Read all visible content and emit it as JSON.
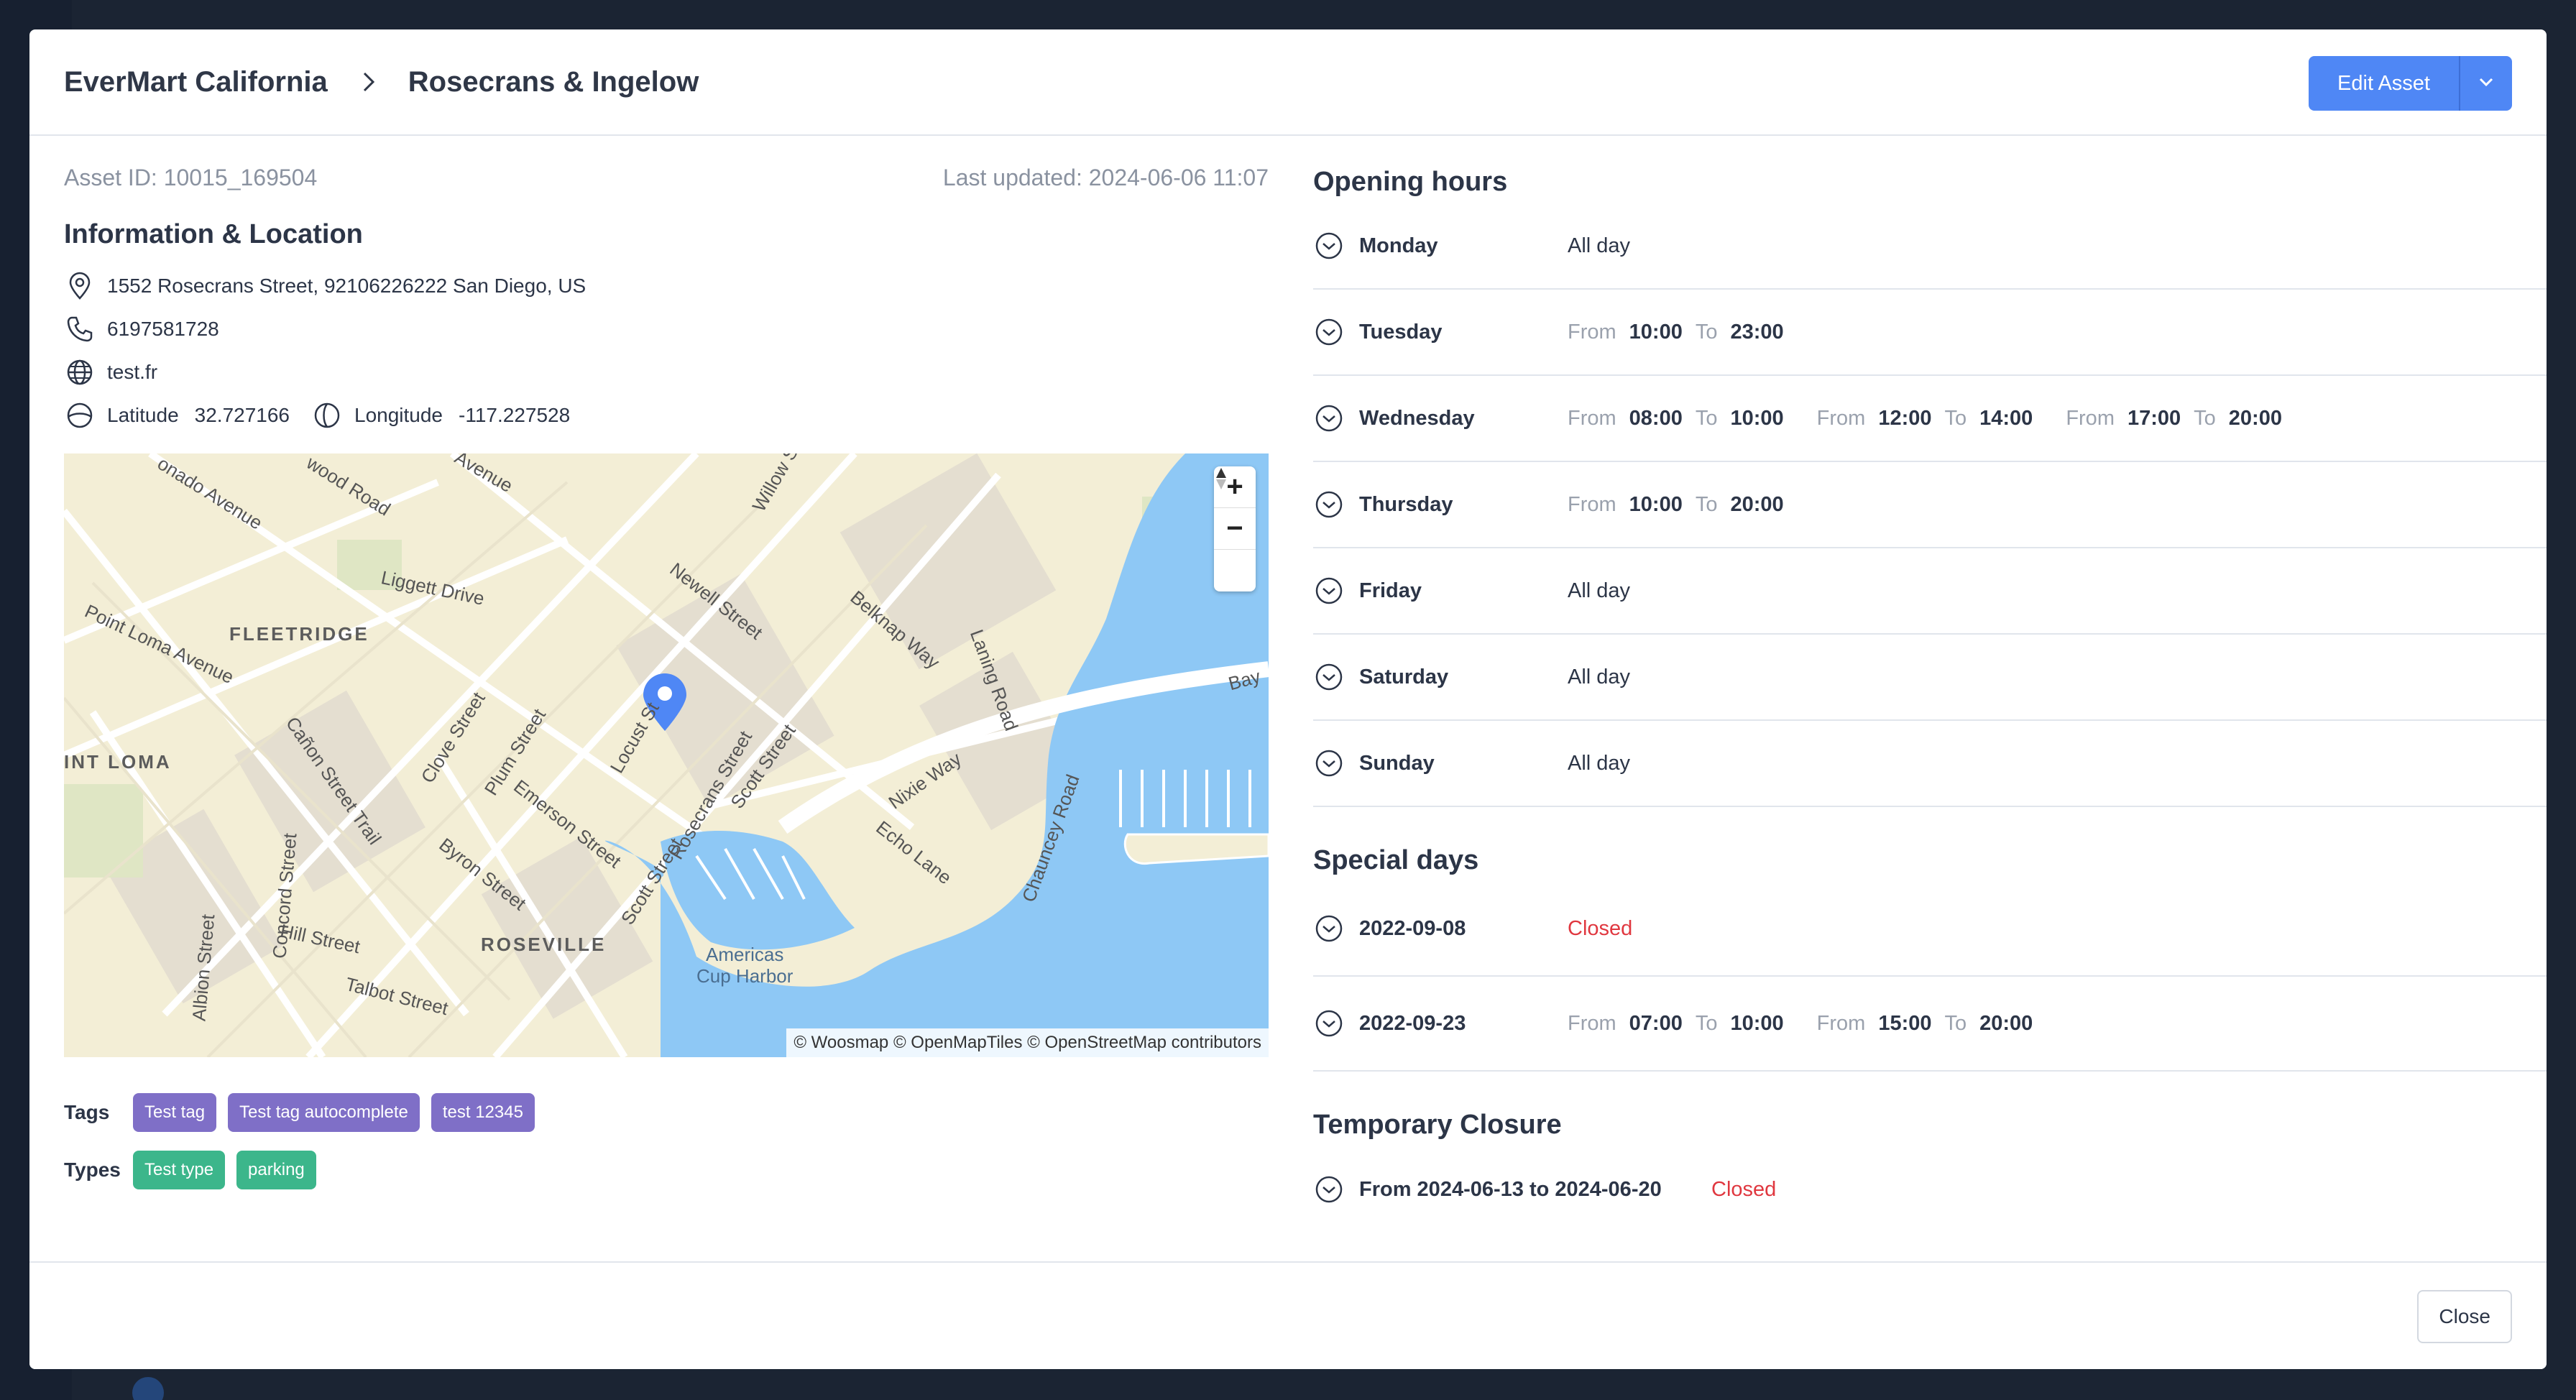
{
  "header": {
    "breadcrumb_parent": "EverMart California",
    "breadcrumb_current": "Rosecrans & Ingelow",
    "edit_button": "Edit Asset"
  },
  "asset": {
    "id_text": "Asset ID: 10015_169504",
    "last_updated": "Last updated: 2024-06-06 11:07",
    "section_title": "Information & Location",
    "address": "1552 Rosecrans Street, 92106226222 San Diego, US",
    "phone": "6197581728",
    "website": "test.fr",
    "latitude_label": "Latitude",
    "latitude": "32.727166",
    "longitude_label": "Longitude",
    "longitude": "-117.227528"
  },
  "map": {
    "attribution": "© Woosmap © OpenMapTiles © OpenStreetMap contributors",
    "zoom_in": "+",
    "zoom_out": "−",
    "labels": {
      "fleetridge": "FLEETRIDGE",
      "point_loma": "INT LOMA",
      "roseville": "ROSEVILLE",
      "americas_cup": "Americas",
      "americas_cup2": "Cup Harbor",
      "liggett": "Liggett Drive",
      "point_loma_ave": "Point Loma Avenue",
      "newell": "Newell Street",
      "belknap": "Belknap Way",
      "laning": "Laning Road",
      "nixie": "Nixie Way",
      "echo": "Echo Lane",
      "chauncey": "Chauncey Road",
      "rosecrans": "Rosecrans Street",
      "scott": "Scott Street",
      "scott2": "Scott Street",
      "locust": "Locust St",
      "clove": "Clove Street",
      "plum": "Plum Street",
      "emerson": "Emerson Street",
      "byron": "Byron Street",
      "hill": "Hill Street",
      "talbot": "Talbot Street",
      "canon": "Cañon Street Trail",
      "concord": "Concord Street",
      "albion": "Albion Street",
      "willow": "Willow S",
      "bay": "Bay",
      "coronado": "onado Avenue",
      "wood": "wood Road",
      "avenue": "Avenue"
    }
  },
  "tags": {
    "label": "Tags",
    "items": [
      "Test tag",
      "Test tag autocomplete",
      "test 12345"
    ]
  },
  "types": {
    "label": "Types",
    "items": [
      "Test type",
      "parking"
    ]
  },
  "opening_hours": {
    "title": "Opening hours",
    "from_word": "From",
    "to_word": "To",
    "days": [
      {
        "name": "Monday",
        "all_day": "All day"
      },
      {
        "name": "Tuesday",
        "slots": [
          [
            "10:00",
            "23:00"
          ]
        ]
      },
      {
        "name": "Wednesday",
        "slots": [
          [
            "08:00",
            "10:00"
          ],
          [
            "12:00",
            "14:00"
          ],
          [
            "17:00",
            "20:00"
          ]
        ]
      },
      {
        "name": "Thursday",
        "slots": [
          [
            "10:00",
            "20:00"
          ]
        ]
      },
      {
        "name": "Friday",
        "all_day": "All day"
      },
      {
        "name": "Saturday",
        "all_day": "All day"
      },
      {
        "name": "Sunday",
        "all_day": "All day"
      }
    ]
  },
  "special_days": {
    "title": "Special days",
    "items": [
      {
        "date": "2022-09-08",
        "status": "Closed"
      },
      {
        "date": "2022-09-23",
        "slots": [
          [
            "07:00",
            "10:00"
          ],
          [
            "15:00",
            "20:00"
          ]
        ]
      }
    ]
  },
  "temporary_closure": {
    "title": "Temporary Closure",
    "range": "From 2024-06-13 to 2024-06-20",
    "status": "Closed"
  },
  "footer": {
    "close_button": "Close"
  },
  "colors": {
    "primary": "#4f87f5",
    "tag_chip": "#7f6fc7",
    "type_chip": "#3cb68b",
    "closed": "#e0373f",
    "water": "#8ec8f5"
  }
}
